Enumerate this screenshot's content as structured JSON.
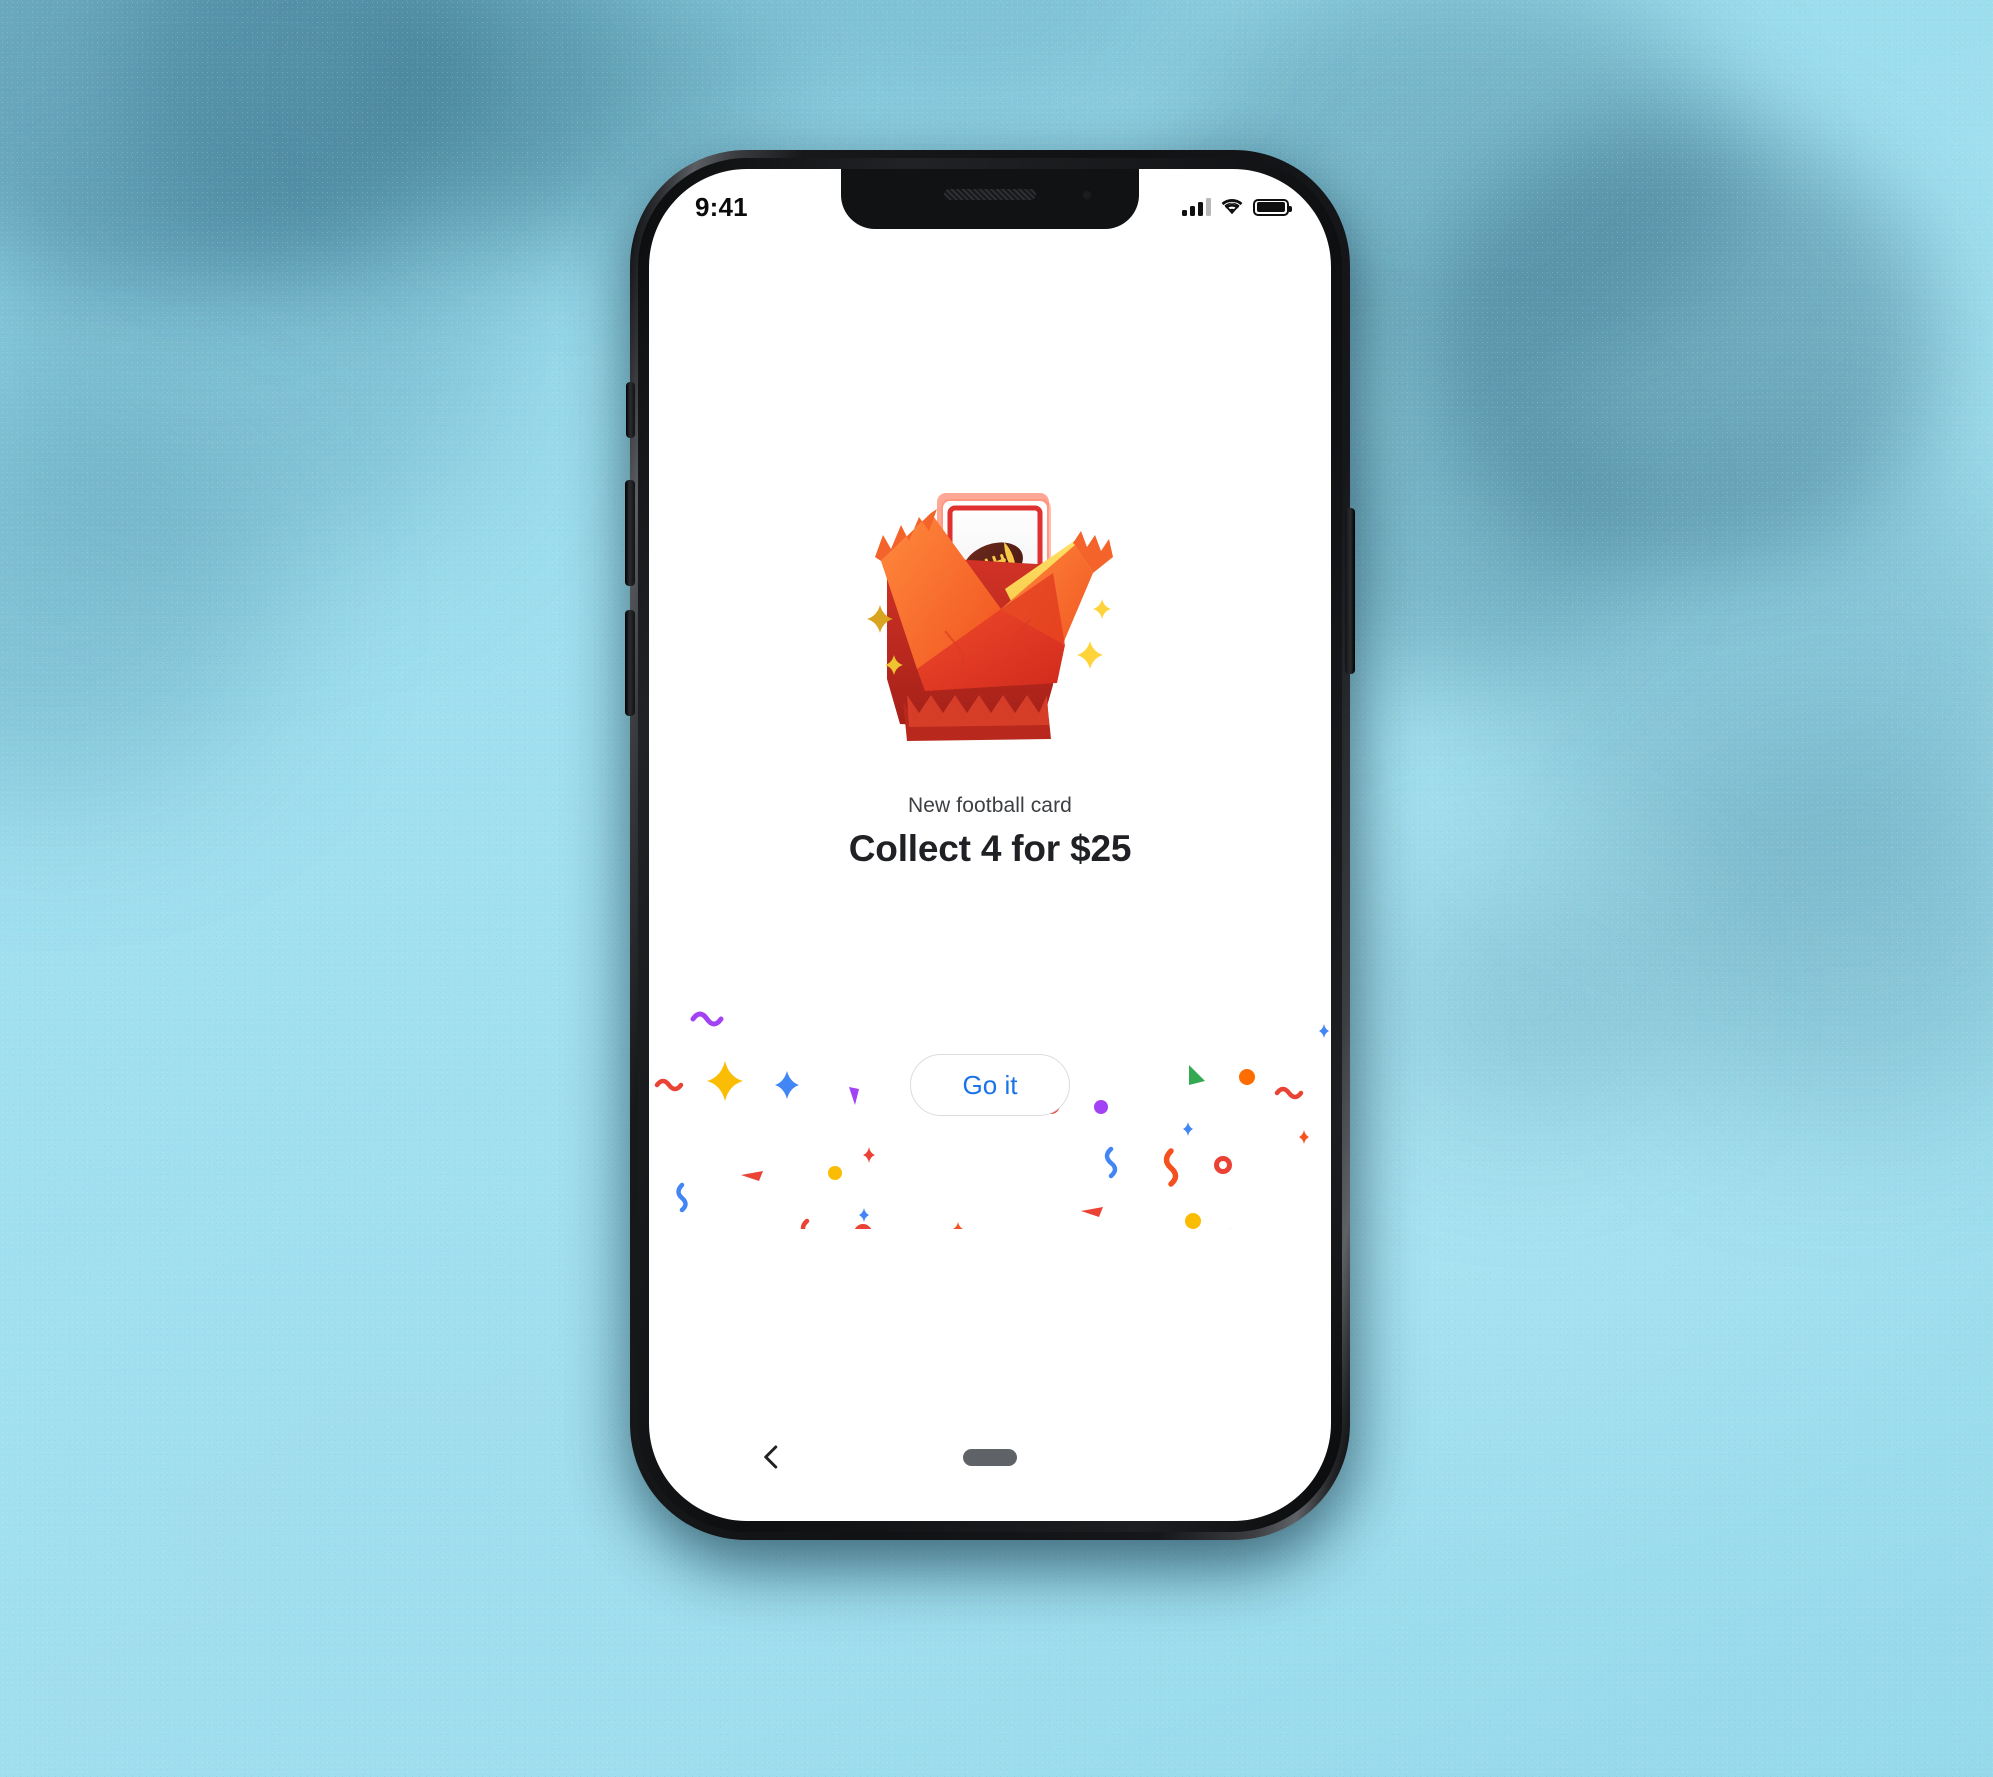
{
  "background": {
    "name": "textured-paper-backdrop",
    "color": "#9fdfef",
    "accent_shadow": "#2a6c8a"
  },
  "device": {
    "name": "smartphone-mockup",
    "frame_color": "#111214",
    "screen_background": "#ffffff"
  },
  "status_bar": {
    "time": "9:41",
    "icons": {
      "cellular": "signal-bars-icon",
      "wifi": "wifi-icon",
      "battery": "battery-icon"
    },
    "signal_bars_total": 4,
    "signal_bars_active": 3,
    "battery_level_percent": 88
  },
  "hero": {
    "name": "card-pack-illustration",
    "alt": "Torn open orange foil card pack revealing a football trading card with gold sparkles",
    "colors": {
      "pack_orange": "#f4642a",
      "pack_orange_light": "#ff7a33",
      "pack_red_dark": "#c52b1f",
      "pack_red": "#e8392a",
      "gold": "#ffd43b",
      "gold_dark": "#d9a520",
      "card_white": "#f5f5f5",
      "card_border_red": "#e03131",
      "football_brown": "#5c2018",
      "football_laces": "#f7c948"
    }
  },
  "content": {
    "eyebrow": "New football card",
    "headline": "Collect 4 for $25"
  },
  "cta": {
    "label": "Go it",
    "text_color": "#1a73e8",
    "border_color": "#dadce0"
  },
  "confetti": {
    "name": "celebration-confetti",
    "palette": [
      "#ea4335",
      "#fbbc04",
      "#4285f4",
      "#34a853",
      "#a142f4",
      "#ff6d00",
      "#f5511e"
    ],
    "shapes": [
      "squiggle",
      "dot",
      "ring",
      "four-point-star",
      "triangle",
      "tick"
    ]
  },
  "nav_bar": {
    "back_label": "back-chevron",
    "home_indicator_label": "home-indicator"
  }
}
